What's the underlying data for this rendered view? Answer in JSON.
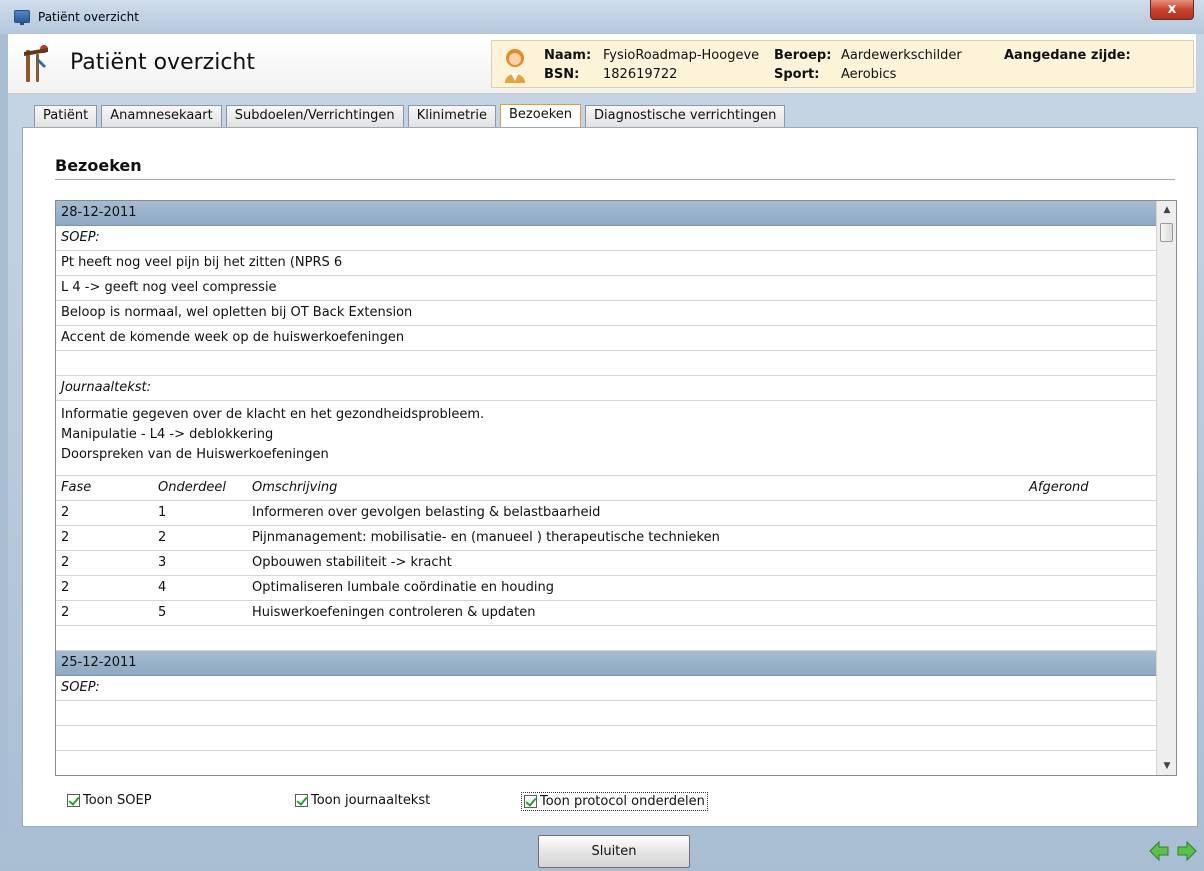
{
  "window": {
    "title": "Patiënt overzicht",
    "close_label": "x"
  },
  "header": {
    "title": "Patiënt overzicht"
  },
  "patient": {
    "naam_label": "Naam:",
    "naam": "FysioRoadmap-Hoogeve",
    "bsn_label": "BSN:",
    "bsn": "182619722",
    "beroep_label": "Beroep:",
    "beroep": "Aardewerkschilder",
    "sport_label": "Sport:",
    "sport": "Aerobics",
    "zijde_label": "Aangedane zijde:"
  },
  "tabs": [
    {
      "label": "Patiënt"
    },
    {
      "label": "Anamnesekaart"
    },
    {
      "label": "Subdoelen/Verrichtingen"
    },
    {
      "label": "Klinimetrie"
    },
    {
      "label": "Bezoeken"
    },
    {
      "label": "Diagnostische verrichtingen"
    }
  ],
  "active_tab": "Bezoeken",
  "section_title": "Bezoeken",
  "visits": [
    {
      "date": "28-12-2011",
      "soep_label": "SOEP:",
      "soep_lines": [
        "Pt heeft nog veel pijn bij het zitten (NPRS 6",
        "L 4 -> geeft nog veel compressie",
        "Beloop is normaal, wel opletten bij OT Back Extension",
        "Accent de komende week op de huiswerkoefeningen"
      ],
      "journaal_label": "Journaaltekst:",
      "journaal_lines": [
        "Informatie gegeven over de klacht en het gezondheidsprobleem.",
        "Manipulatie - L4 -> deblokkering",
        "Doorspreken van de Huiswerkoefeningen"
      ],
      "protocol_headers": {
        "fase": "Fase",
        "onderdeel": "Onderdeel",
        "omschrijving": "Omschrijving",
        "afgerond": "Afgerond"
      },
      "protocol_rows": [
        {
          "fase": "2",
          "onderdeel": "1",
          "omschrijving": "Informeren over gevolgen belasting & belastbaarheid"
        },
        {
          "fase": "2",
          "onderdeel": "2",
          "omschrijving": "Pijnmanagement: mobilisatie- en (manueel ) therapeutische technieken"
        },
        {
          "fase": "2",
          "onderdeel": "3",
          "omschrijving": "Opbouwen stabiliteit -> kracht"
        },
        {
          "fase": "2",
          "onderdeel": "4",
          "omschrijving": "Optimaliseren lumbale coördinatie en houding"
        },
        {
          "fase": "2",
          "onderdeel": "5",
          "omschrijving": "Huiswerkoefeningen controleren & updaten"
        }
      ]
    },
    {
      "date": "25-12-2011",
      "soep_label": "SOEP:"
    }
  ],
  "options": {
    "toon_soep": "Toon SOEP",
    "toon_journaal": "Toon journaaltekst",
    "toon_protocol": "Toon protocol onderdelen"
  },
  "buttons": {
    "sluiten": "Sluiten"
  },
  "colors": {
    "date_row": "#9bb3cc",
    "patient_box": "#fdf3d8",
    "active_tab_border": "#e89a3a",
    "nav_arrow": "#5cc04a"
  }
}
